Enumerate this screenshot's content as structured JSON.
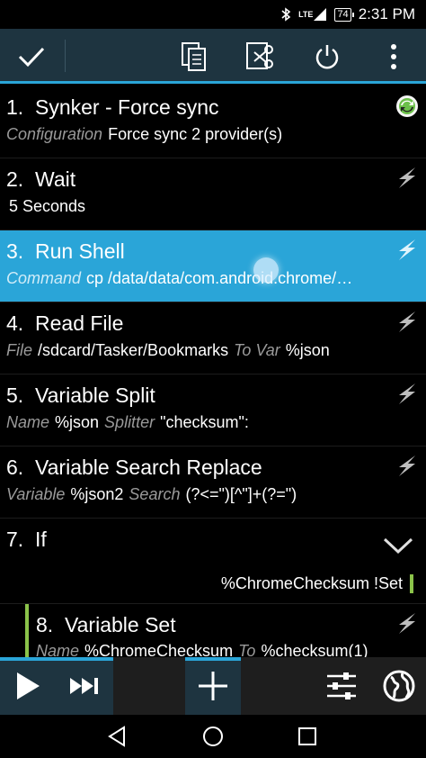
{
  "status_bar": {
    "network": "LTE",
    "battery": "74",
    "time": "2:31 PM"
  },
  "toolbar": {
    "confirm_icon": "checkmark-icon",
    "copy_icon": "copy-icon",
    "cut_icon": "scissors-icon",
    "power_icon": "power-icon",
    "menu_icon": "overflow-menu-icon"
  },
  "actions": [
    {
      "num": "1.",
      "name": "Synker - Force sync",
      "params": [
        {
          "label": "Configuration",
          "value": "Force sync 2 provider(s)"
        }
      ]
    },
    {
      "num": "2.",
      "name": "Wait",
      "params": [
        {
          "label": "",
          "value": "5 Seconds"
        }
      ]
    },
    {
      "num": "3.",
      "name": "Run Shell",
      "params": [
        {
          "label": "Command",
          "value": "cp /data/data/com.android.chrome/…"
        }
      ]
    },
    {
      "num": "4.",
      "name": "Read File",
      "params": [
        {
          "label": "File",
          "value": "/sdcard/Tasker/Bookmarks"
        },
        {
          "label": "To Var",
          "value": "%json"
        }
      ]
    },
    {
      "num": "5.",
      "name": "Variable Split",
      "params": [
        {
          "label": "Name",
          "value": "%json"
        },
        {
          "label": "Splitter",
          "value": "\"checksum\":"
        }
      ]
    },
    {
      "num": "6.",
      "name": "Variable Search Replace",
      "params": [
        {
          "label": "Variable",
          "value": "%json2"
        },
        {
          "label": "Search",
          "value": "(?<=\")[^\"]+(?=\")"
        }
      ]
    },
    {
      "num": "7.",
      "name": "If",
      "condition": "%ChromeChecksum !Set"
    },
    {
      "num": "8.",
      "name": "Variable Set",
      "params": [
        {
          "label": "Name",
          "value": "%ChromeChecksum"
        },
        {
          "label": "To",
          "value": "%checksum(1)"
        }
      ]
    }
  ],
  "bottom_bar": {
    "play_icon": "play-icon",
    "skip_icon": "skip-next-icon",
    "add_icon": "add-icon",
    "settings_icon": "sliders-icon",
    "globe_icon": "globe-icon"
  },
  "colors": {
    "accent": "#2aa5d8",
    "toolbar": "#1e3440",
    "if_block": "#8bc34a"
  }
}
